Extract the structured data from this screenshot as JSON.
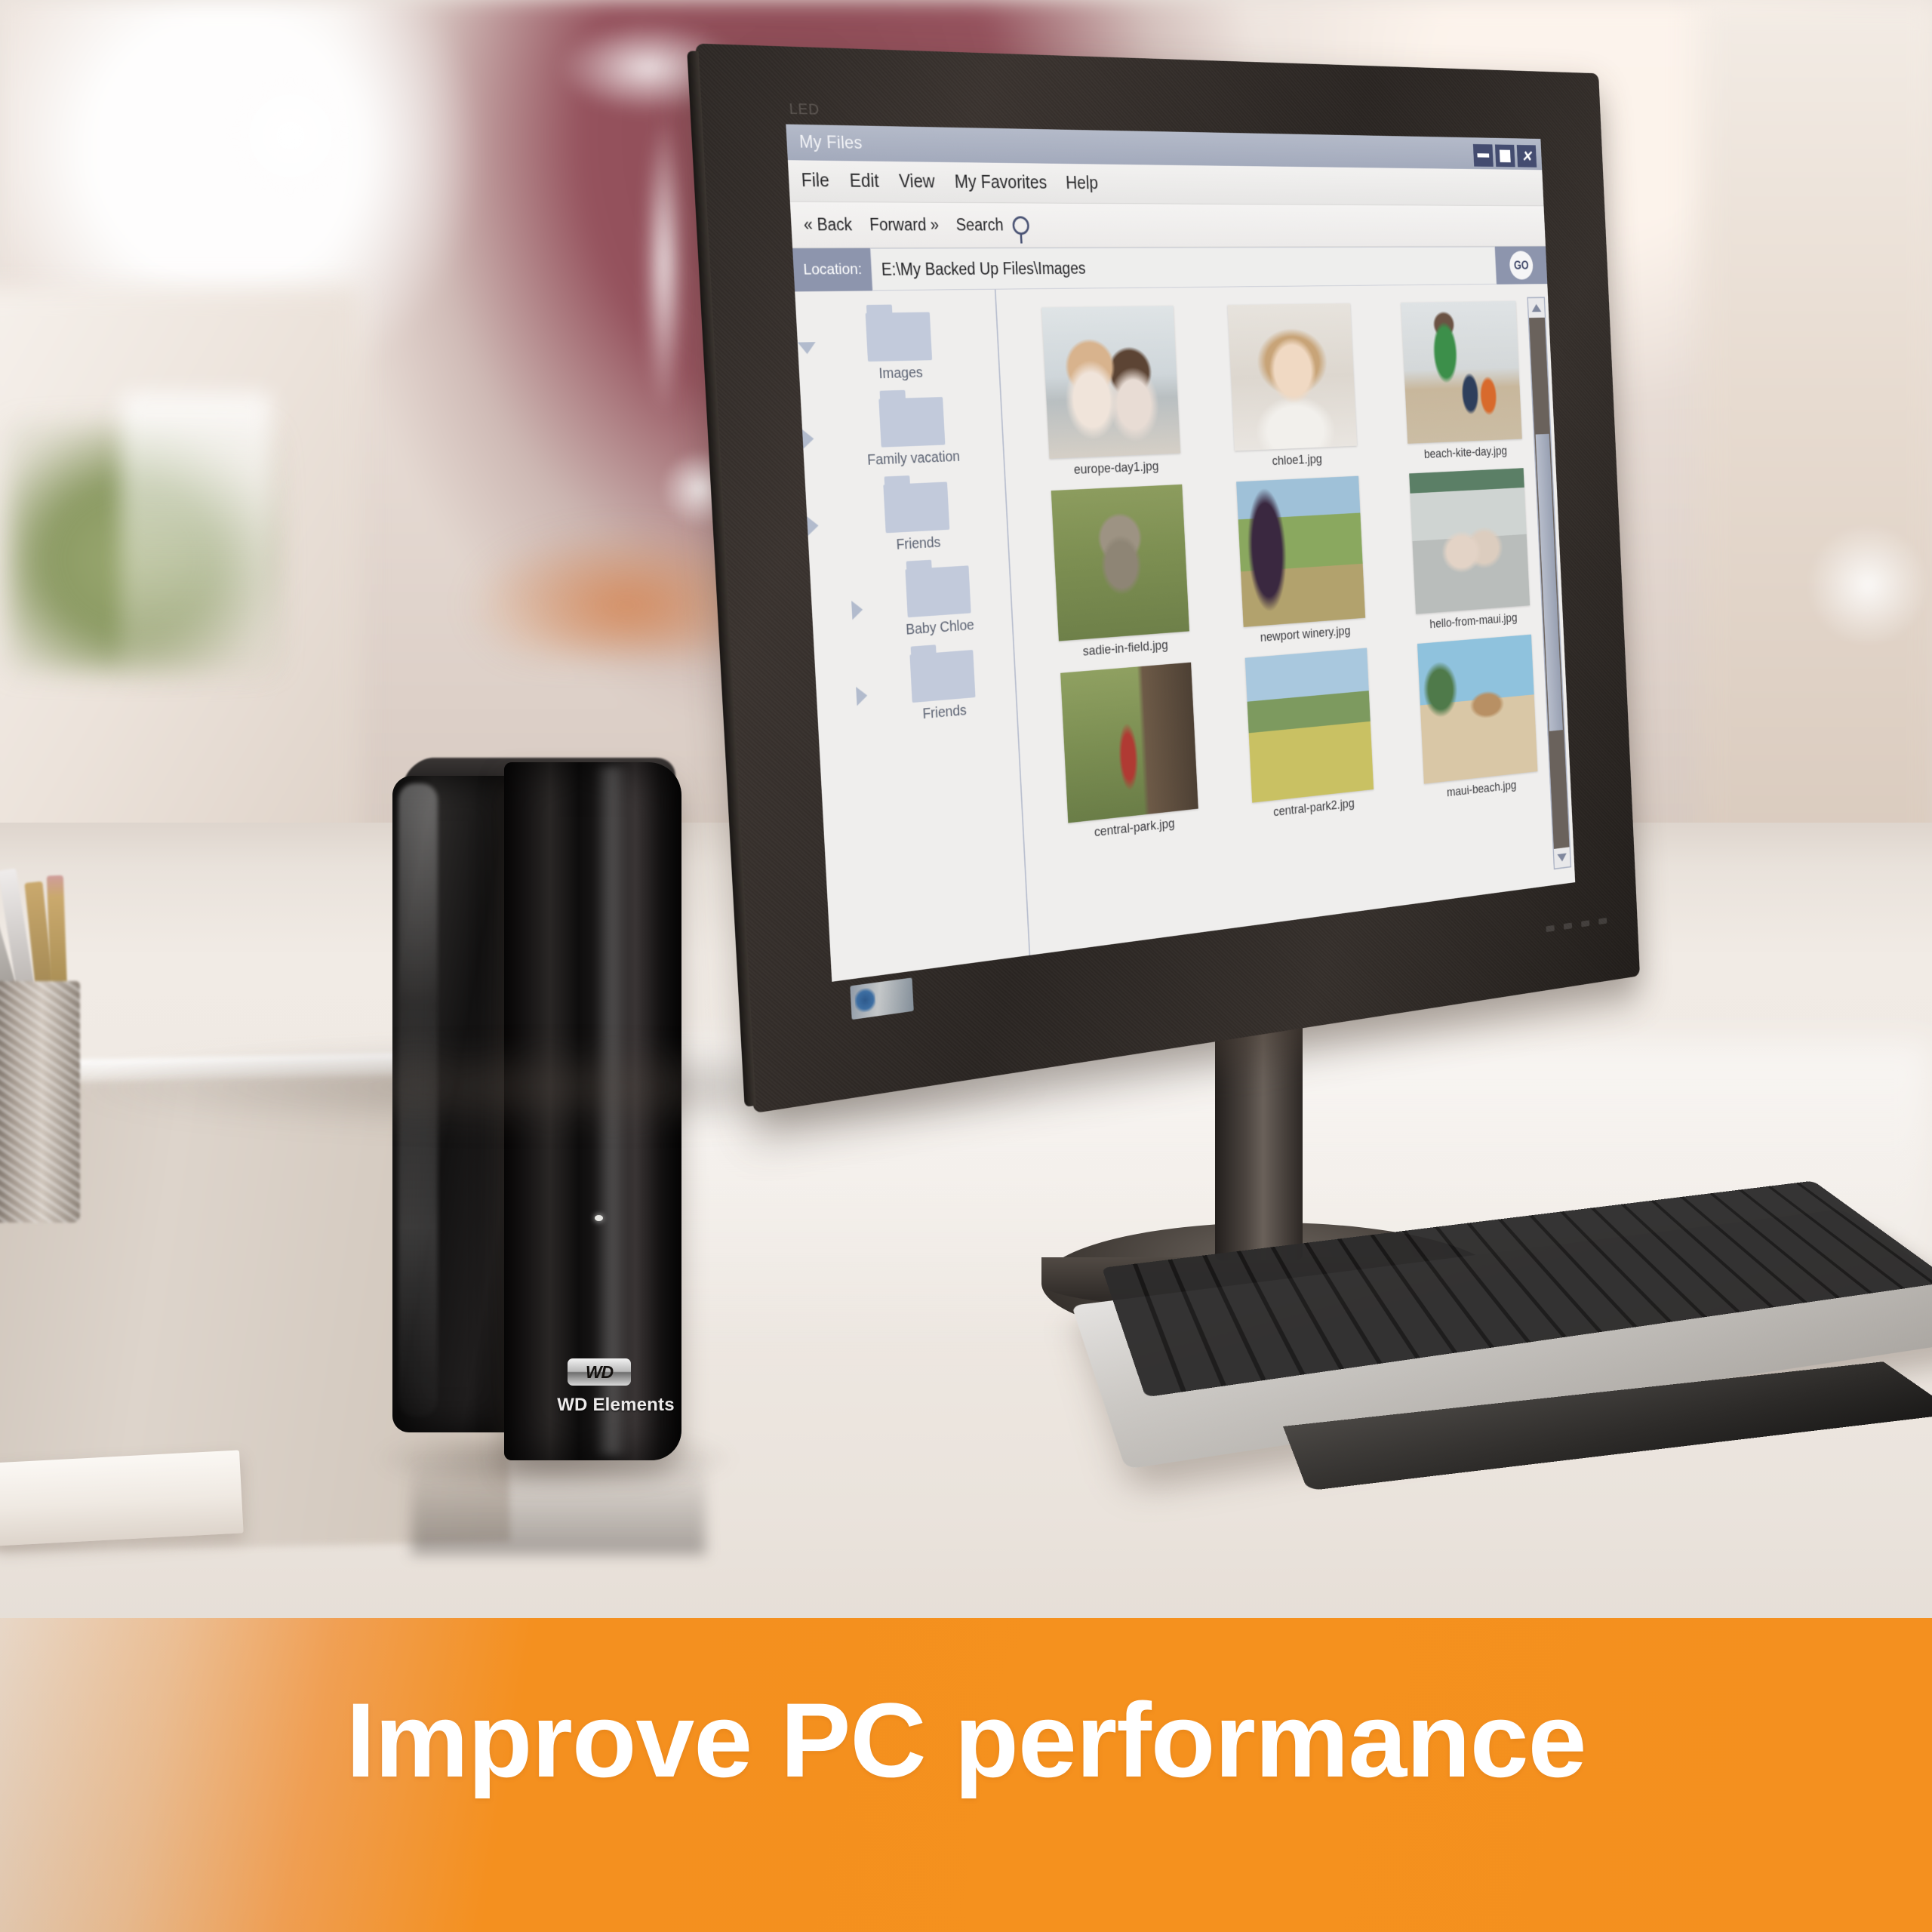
{
  "scene": {
    "product": {
      "logo_text": "WD",
      "model_label": "WD Elements"
    },
    "monitor": {
      "bezel_label": "LED"
    }
  },
  "window": {
    "title": "My Files",
    "menu": [
      "File",
      "Edit",
      "View",
      "My Favorites",
      "Help"
    ],
    "window_controls": {
      "minimize": "–",
      "maximize": "□",
      "close": "✕"
    },
    "toolbar": {
      "back": "« Back",
      "forward": "Forward »",
      "search": "Search"
    },
    "location": {
      "label": "Location:",
      "value": "E:\\My Backed Up Files\\Images",
      "go_label": "GO"
    },
    "tree": [
      {
        "label": "Images",
        "level": 0,
        "state": "open"
      },
      {
        "label": "Family vacation",
        "level": 1,
        "state": "closed"
      },
      {
        "label": "Friends",
        "level": 1,
        "state": "closed"
      },
      {
        "label": "Baby Chloe",
        "level": 2,
        "state": "closed"
      },
      {
        "label": "Friends",
        "level": 2,
        "state": "closed"
      }
    ],
    "files": [
      {
        "name": "europe-day1.jpg",
        "art": "t-europe"
      },
      {
        "name": "chloe1.jpg",
        "art": "t-chloe"
      },
      {
        "name": "beach-kite-day.jpg",
        "art": "t-kite"
      },
      {
        "name": "sadie-in-field.jpg",
        "art": "t-cat"
      },
      {
        "name": "newport winery.jpg",
        "art": "t-winery"
      },
      {
        "name": "hello-from-maui.jpg",
        "art": "t-maui"
      },
      {
        "name": "central-park.jpg",
        "art": "t-bike"
      },
      {
        "name": "central-park2.jpg",
        "art": "t-park2"
      },
      {
        "name": "maui-beach.jpg",
        "art": "t-beach"
      }
    ]
  },
  "banner": {
    "headline": "Improve PC performance",
    "background_color": "#f4901f",
    "text_color": "#ffffff"
  },
  "colors": {
    "titlebar": "#a8aec0",
    "window_button": "#444c70",
    "location_label": "#8d95ad",
    "folder": "#c2cadb",
    "bezel": "#2f2925"
  }
}
